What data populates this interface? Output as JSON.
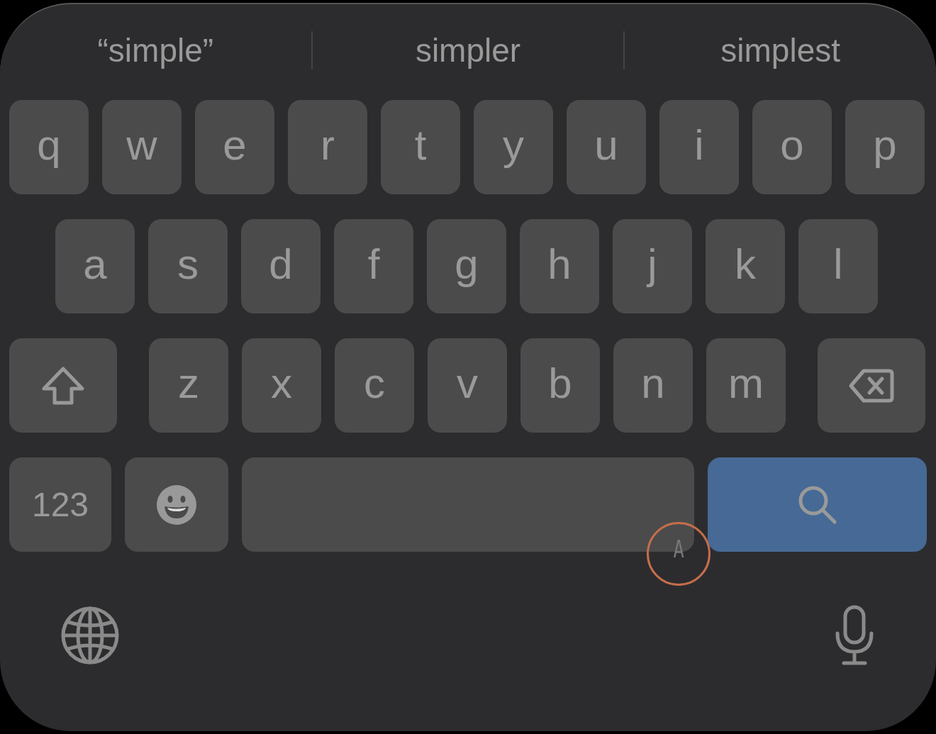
{
  "suggestions": [
    {
      "text": "“simple”"
    },
    {
      "text": "simpler"
    },
    {
      "text": "simplest"
    }
  ],
  "rows": [
    [
      {
        "kind": "letter",
        "label": "q"
      },
      {
        "kind": "letter",
        "label": "w"
      },
      {
        "kind": "letter",
        "label": "e"
      },
      {
        "kind": "letter",
        "label": "r"
      },
      {
        "kind": "letter",
        "label": "t"
      },
      {
        "kind": "letter",
        "label": "y"
      },
      {
        "kind": "letter",
        "label": "u"
      },
      {
        "kind": "letter",
        "label": "i"
      },
      {
        "kind": "letter",
        "label": "o"
      },
      {
        "kind": "letter",
        "label": "p"
      }
    ],
    [
      {
        "kind": "letter",
        "label": "a"
      },
      {
        "kind": "letter",
        "label": "s"
      },
      {
        "kind": "letter",
        "label": "d"
      },
      {
        "kind": "letter",
        "label": "f"
      },
      {
        "kind": "letter",
        "label": "g"
      },
      {
        "kind": "letter",
        "label": "h"
      },
      {
        "kind": "letter",
        "label": "j"
      },
      {
        "kind": "letter",
        "label": "k"
      },
      {
        "kind": "letter",
        "label": "l"
      }
    ],
    [
      {
        "kind": "shift"
      },
      {
        "kind": "letter",
        "label": "z"
      },
      {
        "kind": "letter",
        "label": "x"
      },
      {
        "kind": "letter",
        "label": "c"
      },
      {
        "kind": "letter",
        "label": "v"
      },
      {
        "kind": "letter",
        "label": "b"
      },
      {
        "kind": "letter",
        "label": "n"
      },
      {
        "kind": "letter",
        "label": "m"
      },
      {
        "kind": "delete"
      }
    ],
    [
      {
        "kind": "numbers",
        "label": "123"
      },
      {
        "kind": "emoji"
      },
      {
        "kind": "space"
      },
      {
        "kind": "search"
      }
    ]
  ],
  "touch_marker": {
    "label": "A"
  },
  "bottom_bar": [
    {
      "kind": "globe"
    },
    {
      "kind": "mic"
    }
  ]
}
